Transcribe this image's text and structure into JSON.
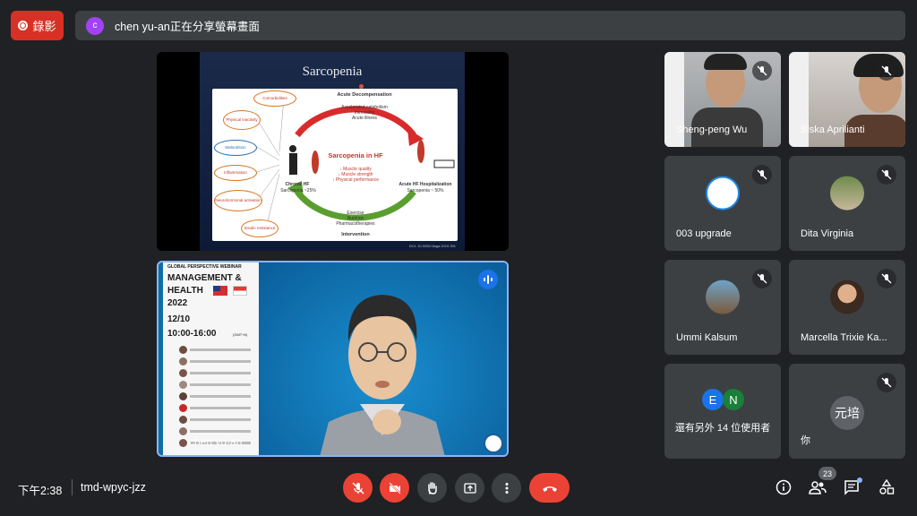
{
  "recording": {
    "label": "錄影"
  },
  "share_banner": {
    "avatar_letter": "c",
    "text": "chen yu-an正在分享螢幕畫面"
  },
  "slide": {
    "title": "Sarcopenia",
    "top_heading": "Acute Decompensation",
    "top_items": [
      "Accelerated catabolism",
      "Immobility",
      "Acute illness"
    ],
    "center_title": "Sarcopenia in HF",
    "center_items": [
      "↓ Muscle quality",
      "↓ Muscle strength",
      "↓ Physical performance"
    ],
    "left_label": "Chronic HF",
    "left_sub": "Sarcopenia ~25%",
    "right_label": "Acute HF Hospitalization",
    "right_sub": "Sarcopenia ~ 50%",
    "bottom_items": [
      "Exercise",
      "Nutrition",
      "Pharmacotherapies"
    ],
    "bottom_heading": "Intervention",
    "ovals": [
      "Comorbidities",
      "Physical inactivity",
      "Malnutrition",
      "Inflammation",
      "Neurohormonal activation",
      "Insulin resistance"
    ],
    "doi": "DOI: 10.5090/Jiaga.2019.391"
  },
  "speaker": {
    "name": "chen yu-an",
    "poster_header": "GLOBAL PERSPECTIVE WEBINAR",
    "poster_title_1": "MANAGEMENT &",
    "poster_title_2": "HEALTH",
    "poster_year": "2022",
    "poster_date": "12/10",
    "poster_time": "10:00-16:00",
    "poster_tz": "(GMT+8)"
  },
  "participants": [
    {
      "name": "Sheng-peng Wu",
      "video": true
    },
    {
      "name": "Siska Aprilianti",
      "video": true
    },
    {
      "name": "003 upgrade",
      "video": false
    },
    {
      "name": "Dita Virginia",
      "video": false
    },
    {
      "name": "Ummi Kalsum",
      "video": false
    },
    {
      "name": "Marcella Trixie Ka...",
      "video": false
    }
  ],
  "others": {
    "label": "還有另外 14 位使用者",
    "avatar_letters": [
      "E",
      "N"
    ]
  },
  "self": {
    "name": "你",
    "avatar_text": "元培"
  },
  "bottom": {
    "time": "下午2:38",
    "meeting_code": "tmd-wpyc-jzz",
    "people_count": "23"
  },
  "colors": {
    "red": "#d93025",
    "bar_bg": "#202124",
    "tile_bg": "#3c4043",
    "accent": "#8ab4f8",
    "speaking": "#1a73e8"
  },
  "icons": [
    "record-icon",
    "mic-off-icon",
    "camera-off-icon",
    "raise-hand-icon",
    "present-icon",
    "more-vert-icon",
    "end-call-icon",
    "info-icon",
    "people-icon",
    "chat-icon",
    "activities-icon"
  ]
}
